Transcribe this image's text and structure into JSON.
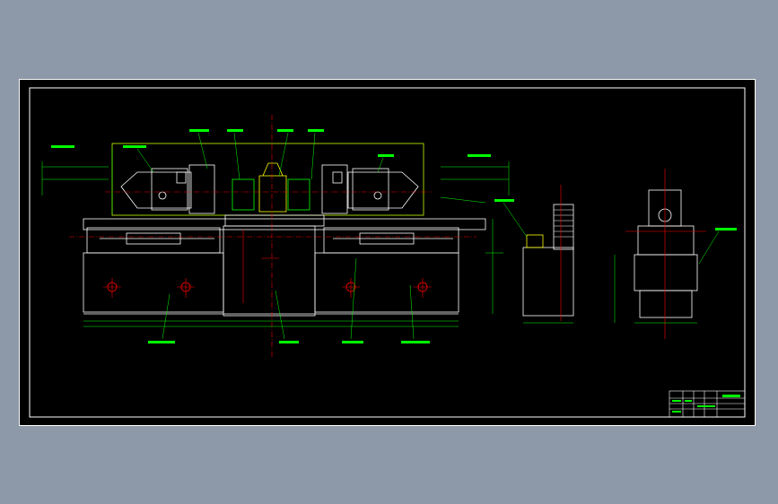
{
  "app": {
    "background": "#8d99a8",
    "canvas_background": "#000000"
  },
  "colors": {
    "outline": "#ffffff",
    "annotation": "#00ff00",
    "centerline": "#ff0000",
    "dimension": "#00ff00"
  },
  "drawing": {
    "title_block": {
      "present": true
    }
  }
}
